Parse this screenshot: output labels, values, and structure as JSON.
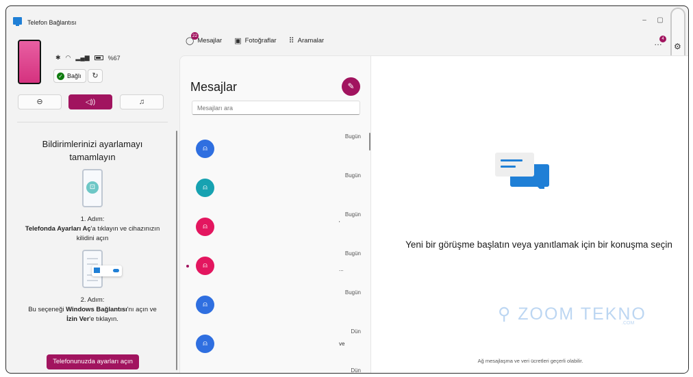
{
  "window": {
    "title": "Telefon Bağlantısı",
    "controls": [
      "–",
      "▢",
      "✕"
    ]
  },
  "phone_status": {
    "battery": "%67",
    "connection_label": "Bağlı",
    "modes": [
      {
        "name": "do-not-disturb",
        "icon": "⊖"
      },
      {
        "name": "sound",
        "icon": "🔊"
      },
      {
        "name": "music",
        "icon": "♫"
      }
    ]
  },
  "setup": {
    "title": "Bildirimlerinizi ayarlamayı tamamlayın",
    "step1": {
      "heading": "1. Adım:",
      "bold": "Telefonda Ayarları Aç",
      "rest": "'a tıklayın ve cihazınızın kilidini açın"
    },
    "step2": {
      "heading": "2. Adım:",
      "pre": "Bu seçeneği ",
      "bold1": "Windows Bağlantısı",
      "mid": "'nı açın ve ",
      "bold2": "İzin Ver",
      "rest": "'e tıklayın."
    },
    "button": "Telefonunuzda ayarları açın"
  },
  "tabs": [
    {
      "label": "Mesajlar",
      "badge": "22",
      "icon": "chat-icon"
    },
    {
      "label": "Fotoğraflar",
      "icon": "photo-icon"
    },
    {
      "label": "Aramalar",
      "icon": "dialpad-icon"
    }
  ],
  "header": {
    "more_badge": "4"
  },
  "conversations": {
    "title": "Mesajlar",
    "search_placeholder": "Mesajları ara",
    "items": [
      {
        "date": "Bugün",
        "color": "#2f6fe0",
        "snippet": "",
        "unread": false
      },
      {
        "date": "Bugün",
        "color": "#17a2b1",
        "snippet": "",
        "unread": false
      },
      {
        "date": "Bugün",
        "color": "#e3165f",
        "snippet": "'",
        "unread": false
      },
      {
        "date": "Bugün",
        "color": "#e3165f",
        "snippet": "...",
        "unread": true
      },
      {
        "date": "Bugün",
        "color": "#2f6fe0",
        "snippet": "",
        "unread": false
      },
      {
        "date": "Dün",
        "color": "#2f6fe0",
        "snippet": "ve",
        "unread": false
      },
      {
        "date": "Dün",
        "color": "#17a2b1",
        "snippet": "",
        "unread": false
      }
    ]
  },
  "main": {
    "empty_text": "Yeni bir görüşme başlatın veya yanıtlamak için bir konuşma seçin",
    "watermark": "ZOOM TEKNO",
    "watermark_sub": ".COM",
    "footer": "Ağ mesajlaşma ve veri ücretleri geçerli olabilir."
  }
}
